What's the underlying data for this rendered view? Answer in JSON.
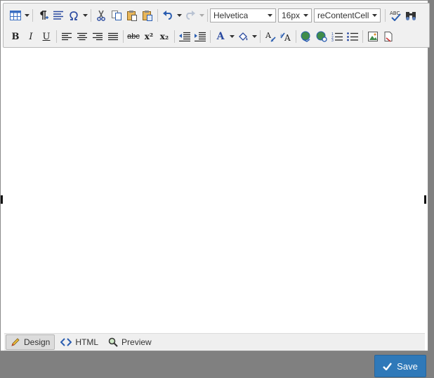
{
  "toolbar": {
    "font_family": "Helvetica",
    "font_size": "16px",
    "css_class": "reContentCell",
    "bold": "B",
    "italic": "I",
    "underline": "U",
    "strike": "abc",
    "superscript": "x²",
    "subscript": "x₂",
    "font_color": "A",
    "format_stripper": "A",
    "case_toggle": "A"
  },
  "modes": [
    {
      "label": "Design",
      "icon": "pencil-icon",
      "active": true
    },
    {
      "label": "HTML",
      "icon": "code-icon",
      "active": false
    },
    {
      "label": "Preview",
      "icon": "magnifier-icon",
      "active": false
    }
  ],
  "save_label": "Save",
  "colors": {
    "background": "#808080",
    "save_button": "#2f79b9",
    "icon_blue": "#2a5db0",
    "toolbar_bg": "#f0f0f0"
  }
}
